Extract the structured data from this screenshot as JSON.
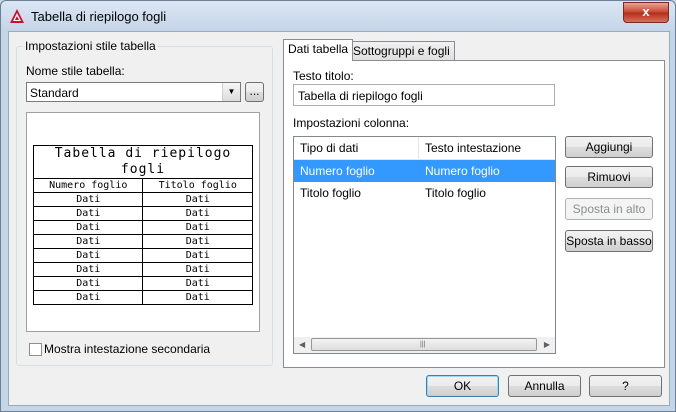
{
  "window": {
    "title": "Tabella di riepilogo fogli",
    "close_label": "x"
  },
  "left_group": {
    "title": "Impostazioni stile tabella",
    "style_label": "Nome stile tabella:",
    "style_value": "Standard",
    "browse_label": "...",
    "preview": {
      "title": "Tabella di riepilogo fogli",
      "headers": [
        "Numero foglio",
        "Titolo foglio"
      ],
      "cell_text": "Dati",
      "rows": [
        [
          "Dati",
          "Dati"
        ],
        [
          "Dati",
          "Dati"
        ],
        [
          "Dati",
          "Dati"
        ],
        [
          "Dati",
          "Dati"
        ],
        [
          "Dati",
          "Dati"
        ],
        [
          "Dati",
          "Dati"
        ],
        [
          "Dati",
          "Dati"
        ],
        [
          "Dati",
          "Dati"
        ]
      ]
    },
    "secondary_header_label": "Mostra intestazione secondaria",
    "secondary_header_checked": false
  },
  "tabs": [
    {
      "label": "Dati tabella",
      "active": true
    },
    {
      "label": "Sottogruppi e fogli",
      "active": false
    }
  ],
  "data_tab": {
    "title_text_label": "Testo titolo:",
    "title_text_value": "Tabella di riepilogo fogli",
    "column_settings_label": "Impostazioni colonna:",
    "columns": {
      "headers": [
        "Tipo di dati",
        "Testo intestazione"
      ],
      "rows": [
        {
          "type": "Numero foglio",
          "header": "Numero foglio",
          "selected": true
        },
        {
          "type": "Titolo foglio",
          "header": "Titolo foglio",
          "selected": false
        }
      ]
    },
    "buttons": {
      "add": "Aggiungi",
      "remove": "Rimuovi",
      "move_up": "Sposta in alto",
      "move_down": "Sposta in basso"
    }
  },
  "footer": {
    "ok": "OK",
    "cancel": "Annulla",
    "help": "?"
  }
}
